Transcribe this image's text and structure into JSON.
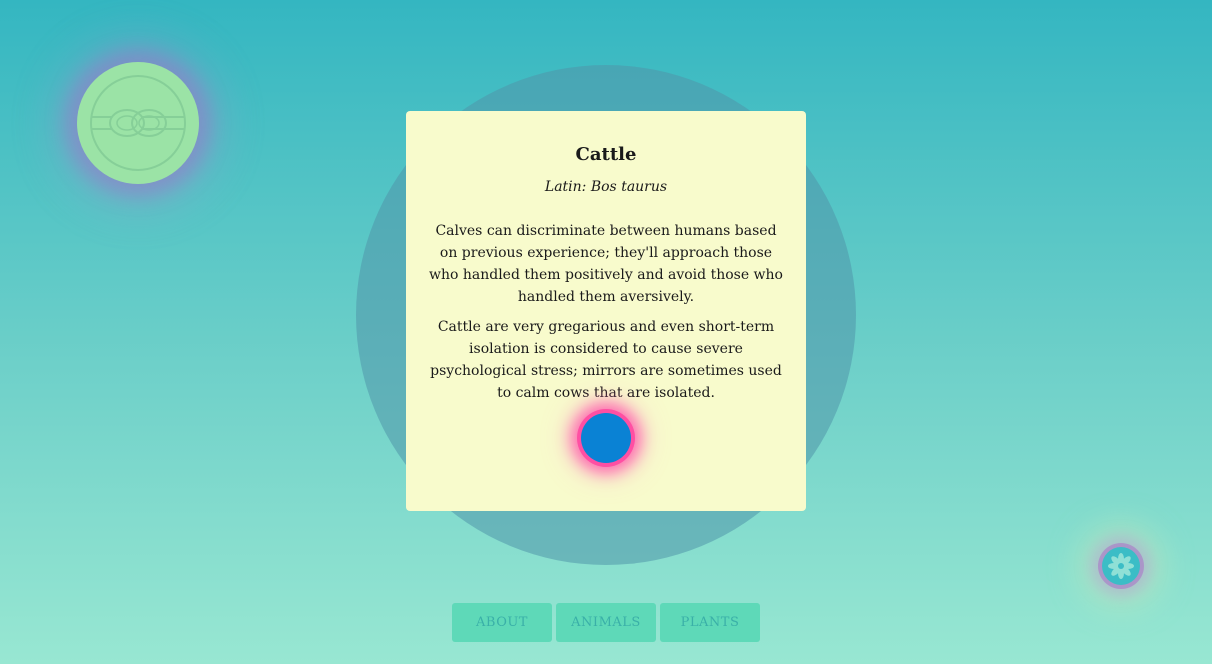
{
  "card": {
    "title": "Cattle",
    "latin": "Latin: Bos taurus",
    "facts": [
      "Calves can discriminate between humans based on previous experience; they'll approach those who handled them positively and avoid those who handled them aversively.",
      "Cattle are very gregarious and even short-term isolation is considered to cause severe psychological stress; mirrors are sometimes used to calm cows that are isolated."
    ]
  },
  "nav": {
    "about": "ABOUT",
    "animals": "ANIMALS",
    "plants": "PLANTS"
  },
  "icons": {
    "logo": "knot-icon",
    "flower": "flower-icon",
    "orb": "orb-button"
  },
  "colors": {
    "card_background": "#f8fbcc",
    "orb": "#0a82d4",
    "orb_glow": "#ff4fa3",
    "nav_button": "#5ed9b8",
    "logo_circle": "#9be3a6"
  }
}
